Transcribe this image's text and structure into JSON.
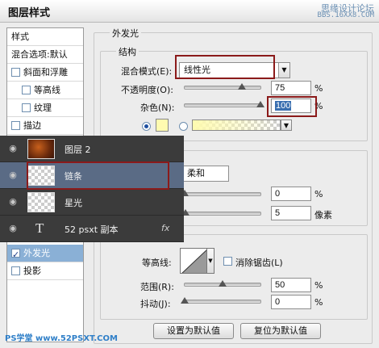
{
  "window": {
    "title": "图层样式",
    "watermark_line1": "思缘设计论坛",
    "watermark_line2": "BBS.16XX8.COM",
    "bottom_watermark": "PS学堂 www.52PSXT.COM"
  },
  "left_panel": {
    "items": [
      {
        "label": "样式",
        "checkbox": false,
        "checked": false,
        "selected": false
      },
      {
        "label": "混合选项:默认",
        "checkbox": false,
        "checked": false,
        "selected": false
      },
      {
        "label": "斜面和浮雕",
        "checkbox": true,
        "checked": false,
        "selected": false
      },
      {
        "label": "等高线",
        "checkbox": true,
        "checked": false,
        "selected": false
      },
      {
        "label": "纹理",
        "checkbox": true,
        "checked": false,
        "selected": false
      },
      {
        "label": "描边",
        "checkbox": true,
        "checked": false,
        "selected": false
      },
      {
        "label": "外发光",
        "checkbox": true,
        "checked": true,
        "selected": true
      },
      {
        "label": "投影",
        "checkbox": true,
        "checked": false,
        "selected": false
      }
    ]
  },
  "outer_glow": {
    "section_title": "外发光",
    "structure_title": "结构",
    "blend_mode_label": "混合模式(E):",
    "blend_mode_value": "线性光",
    "opacity_label": "不透明度(O):",
    "opacity_value": "75",
    "opacity_fraction": 0.75,
    "noise_label": "杂色(N):",
    "noise_value": "100",
    "noise_fraction": 1.0,
    "percent": "%"
  },
  "elements": {
    "technique_value": "柔和",
    "spread_value": "0",
    "size_value": "5",
    "size_unit": "像素",
    "percent": "%"
  },
  "quality": {
    "contour_label": "等高线:",
    "anti_alias_label": "消除锯齿(L)",
    "range_label": "范围(R):",
    "range_value": "50",
    "range_fraction": 0.5,
    "jitter_label": "抖动(J):",
    "jitter_value": "0",
    "jitter_fraction": 0.0,
    "percent": "%"
  },
  "buttons": {
    "set_default": "设置为默认值",
    "reset_default": "复位为默认值"
  },
  "layers": [
    {
      "name": "图层 2",
      "type": "image",
      "selected": false
    },
    {
      "name": "链条",
      "type": "transparent",
      "selected": true
    },
    {
      "name": "星光",
      "type": "transparent",
      "selected": false
    },
    {
      "name": "52 psxt 副本",
      "type": "text",
      "selected": false,
      "fx": "fx"
    }
  ],
  "colors": {
    "glow_color": "#fffbb0",
    "highlight_box": "#8b1a1a",
    "selected_item": "#8ab0d6",
    "layer_selected": "#5a6b85"
  }
}
